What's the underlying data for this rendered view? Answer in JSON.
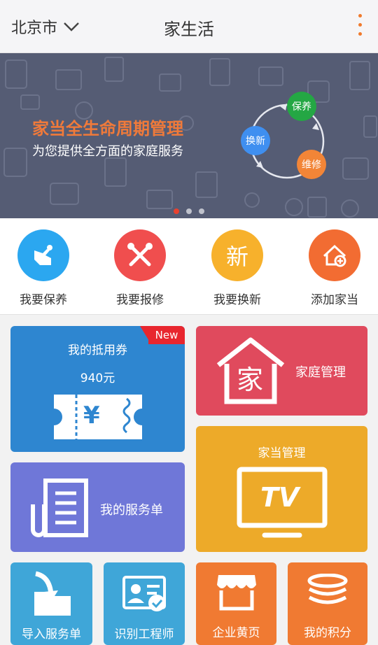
{
  "header": {
    "city": "北京市",
    "title": "家生活"
  },
  "banner": {
    "title": "家当全生命周期管理",
    "subtitle": "为您提供全方面的家庭服务",
    "cycle": [
      "保养",
      "换新",
      "维修"
    ],
    "slide_count": 3,
    "active_slide": 1
  },
  "quick_actions": [
    {
      "label": "我要保养",
      "icon": "hand-wrench-icon",
      "color": "#2ba7f0"
    },
    {
      "label": "我要报修",
      "icon": "tools-icon",
      "color": "#f04e4e"
    },
    {
      "label": "我要换新",
      "icon": "new-char-icon",
      "glyph": "新",
      "color": "#f7b12c"
    },
    {
      "label": "添加家当",
      "icon": "house-plus-icon",
      "color": "#f26c32"
    }
  ],
  "tiles": {
    "voucher": {
      "title": "我的抵用券",
      "amount": "940元",
      "badge": "New",
      "icon": "ticket-yen-icon",
      "yen": "¥"
    },
    "family": {
      "title": "家庭管理",
      "icon": "house-jia-icon",
      "glyph": "家"
    },
    "order": {
      "title": "我的服务单",
      "icon": "document-icon"
    },
    "device": {
      "title": "家当管理",
      "icon": "tv-icon",
      "glyph": "TV"
    },
    "import": {
      "title": "导入服务单",
      "icon": "folder-import-icon"
    },
    "engineer": {
      "title": "识别工程师",
      "icon": "id-card-check-icon"
    },
    "yellow_pages": {
      "title": "企业黄页",
      "icon": "storefront-icon"
    },
    "points": {
      "title": "我的积分",
      "icon": "coins-stack-icon"
    }
  }
}
